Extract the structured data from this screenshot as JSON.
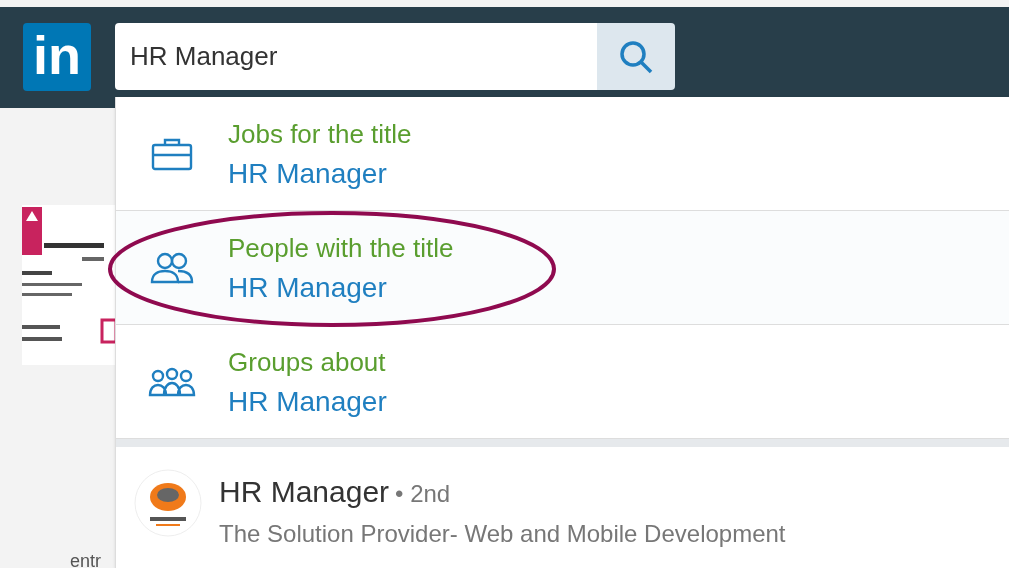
{
  "logo": {
    "text": "in"
  },
  "search": {
    "value": "HR Manager"
  },
  "suggestions": [
    {
      "kind": "jobs",
      "label": "Jobs for the title",
      "value": "HR Manager",
      "selected": false
    },
    {
      "kind": "people",
      "label": "People with the title",
      "value": "HR Manager",
      "selected": true
    },
    {
      "kind": "groups",
      "label": "Groups about",
      "value": "HR Manager",
      "selected": false
    }
  ],
  "result": {
    "name": "HR Manager",
    "degree": "• 2nd",
    "headline": "The Solution Provider- Web and Mobile Development"
  },
  "background": {
    "partial_text": "entr"
  }
}
